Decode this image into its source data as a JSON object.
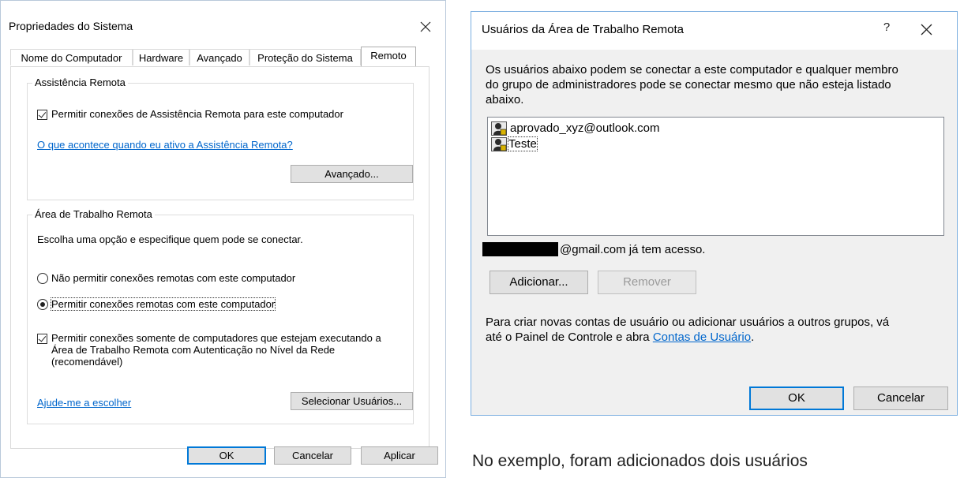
{
  "left_dialog": {
    "title": "Propriedades do Sistema",
    "tabs": [
      {
        "label": "Nome do Computador"
      },
      {
        "label": "Hardware"
      },
      {
        "label": "Avançado"
      },
      {
        "label": "Proteção do Sistema"
      },
      {
        "label": "Remoto"
      }
    ],
    "remote_assistance": {
      "group_title": "Assistência Remota",
      "checkbox_label": "Permitir conexões de Assistência Remota para este computador",
      "checkbox_checked": true,
      "help_link": "O que acontece quando eu ativo a Assistência Remota?",
      "advanced_button": "Avançado..."
    },
    "remote_desktop": {
      "group_title": "Área de Trabalho Remota",
      "instruction": "Escolha uma opção e especifique quem pode se conectar.",
      "radio_deny": "Não permitir conexões remotas com este computador",
      "radio_allow": "Permitir conexões remotas com este computador",
      "selected": "allow",
      "nla_line1": "Permitir conexões somente de computadores que estejam executando a",
      "nla_line2": "Área de Trabalho Remota com Autenticação no Nível da Rede",
      "nla_line3": "(recomendável)",
      "nla_checked": true,
      "help_link": "Ajude-me a escolher",
      "select_users_button": "Selecionar Usuários..."
    },
    "buttons": {
      "ok": "OK",
      "cancel": "Cancelar",
      "apply": "Aplicar"
    }
  },
  "right_dialog": {
    "title": "Usuários da Área de Trabalho Remota",
    "help_glyph": "?",
    "description_line1": "Os usuários abaixo podem se conectar a este computador e qualquer membro",
    "description_line2": "do grupo de administradores pode se conectar mesmo que não esteja listado",
    "description_line3": "abaixo.",
    "users": [
      {
        "name": "aprovado_xyz@outlook.com",
        "icon": "user-icon"
      },
      {
        "name": "Teste",
        "icon": "user-icon"
      }
    ],
    "access_note": "@gmail.com já tem acesso.",
    "add_button": "Adicionar...",
    "remove_button": "Remover",
    "footer_line1": "Para criar novas contas de usuário ou adicionar usuários a outros grupos, vá",
    "footer_line2_prefix": "até o Painel de Controle e abra",
    "footer_link": "Contas de Usuário",
    "footer_suffix": ".",
    "ok_button": "OK",
    "cancel_button": "Cancelar"
  },
  "caption": "No exemplo, foram adicionados dois usuários",
  "colors": {
    "accent": "#0078d7",
    "link": "#0066cc",
    "redaction": "#000000"
  }
}
